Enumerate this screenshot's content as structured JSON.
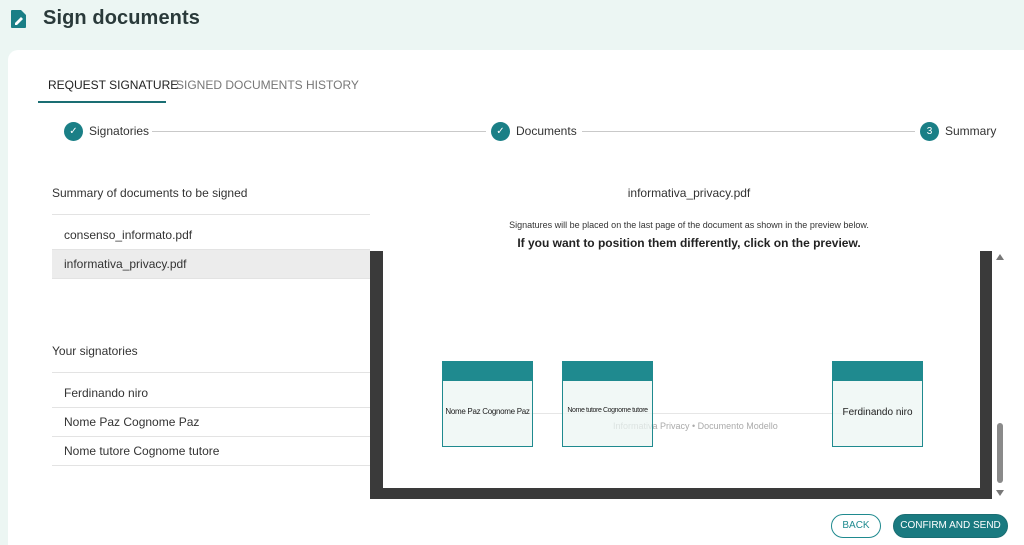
{
  "header": {
    "title": "Sign documents",
    "icon": "sign-document-icon"
  },
  "tabs": [
    {
      "label": "REQUEST SIGNATURE",
      "active": true
    },
    {
      "label": "SIGNED DOCUMENTS HISTORY",
      "active": false
    }
  ],
  "steps": [
    {
      "label": "Signatories",
      "state": "done",
      "marker": "✓"
    },
    {
      "label": "Documents",
      "state": "done",
      "marker": "✓"
    },
    {
      "label": "Summary",
      "state": "current",
      "marker": "3"
    }
  ],
  "documents": {
    "title": "Summary of documents to be signed",
    "items": [
      {
        "name": "consenso_informato.pdf",
        "selected": false
      },
      {
        "name": "informativa_privacy.pdf",
        "selected": true
      }
    ]
  },
  "signatories": {
    "title": "Your signatories",
    "items": [
      "Ferdinando niro",
      "Nome Paz Cognome Paz",
      "Nome tutore Cognome tutore"
    ]
  },
  "preview": {
    "filename": "informativa_privacy.pdf",
    "note": "Signatures will be placed on the last page of the document as shown in the preview below.",
    "note_bold": "If you want to position them differently, click on the preview.",
    "page_footer": "Informativa Privacy • Documento Modello",
    "signature_boxes": [
      "Nome Paz Cognome Paz",
      "Nome tutore Cognome tutore",
      "Ferdinando niro"
    ]
  },
  "buttons": {
    "back": "BACK",
    "confirm": "CONFIRM AND SEND"
  },
  "colors": {
    "accent": "#1a7f86",
    "background": "#ecf6f3",
    "selected_row": "#ececec",
    "preview_frame": "#3a3a3a"
  }
}
